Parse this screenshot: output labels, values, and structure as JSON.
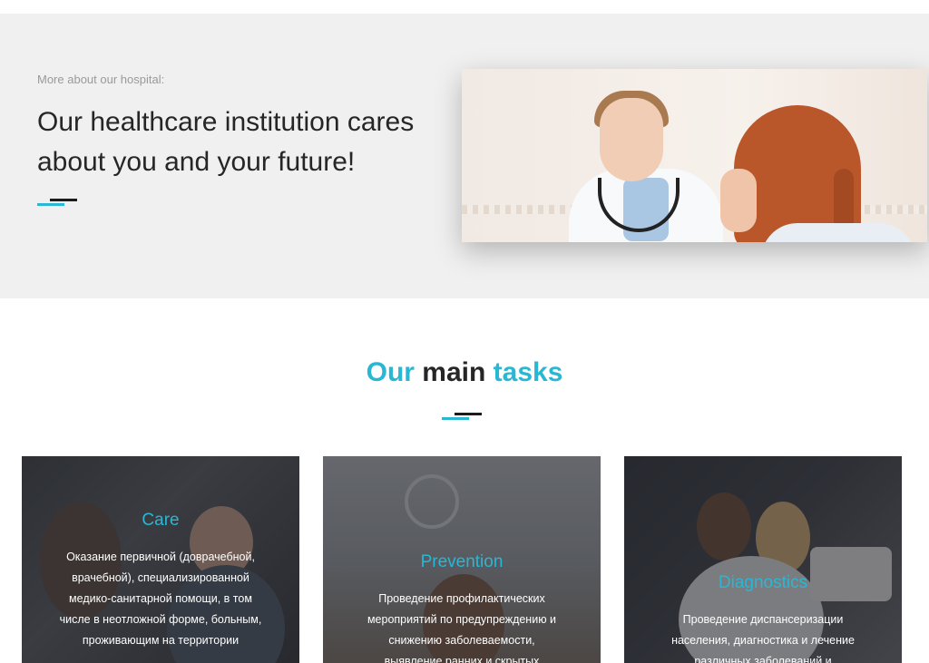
{
  "about": {
    "kicker": "More about our hospital:",
    "headline": "Our healthcare institution cares about you and your future!"
  },
  "tasks": {
    "title_part1": "Our",
    "title_part2": " main ",
    "title_part3": "tasks"
  },
  "cards": [
    {
      "title": "Care",
      "text": "Оказание первичной (доврачебной, врачебной), специализированной медико-санитарной помощи, в том числе в неотложной форме, больным, проживающим на территории"
    },
    {
      "title": "Prevention",
      "text": "Проведение профилактических мероприятий по предупреждению и снижению заболеваемости, выявление ранних и скрытых"
    },
    {
      "title": "Diagnostics",
      "text": "Проведение диспансеризации населения, диагностика и лечение различных заболеваний и"
    }
  ],
  "colors": {
    "accent": "#2ab7d3",
    "dark": "#1b1b1b",
    "section_bg": "#f0f0f0"
  }
}
